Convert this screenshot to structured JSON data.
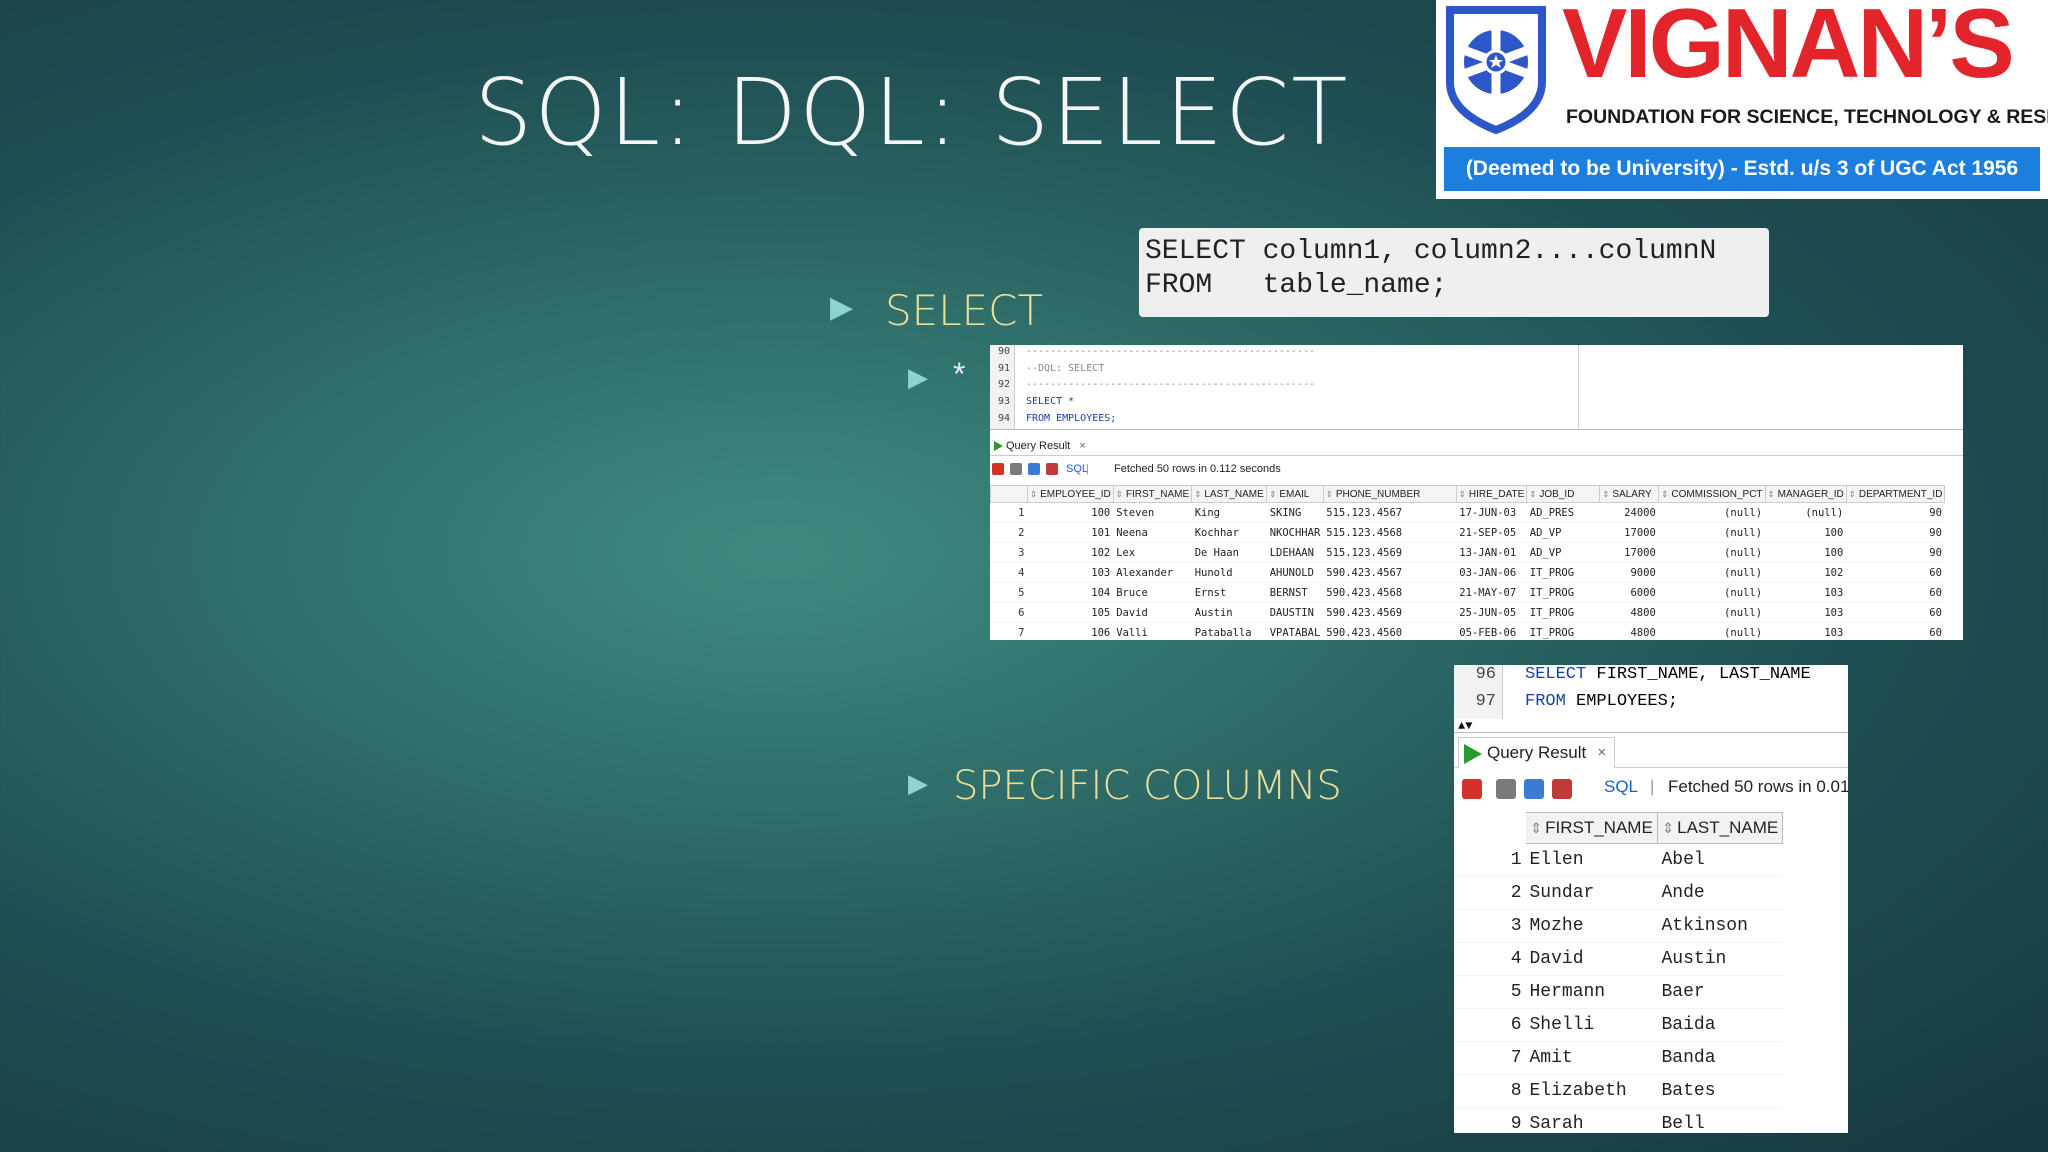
{
  "slide": {
    "title": "SQL: DQL: SELECT",
    "bullets": {
      "select": "SELECT",
      "star": "*",
      "specific": "SPECIFIC COLUMNS"
    },
    "syntax": {
      "line1": "SELECT column1, column2....columnN",
      "line2": "FROM   table_name;"
    }
  },
  "logo": {
    "brand": "VIGNAN’S",
    "subtitle": "FOUNDATION FOR SCIENCE, TECHNOLOGY & RESEARCH",
    "band": "(Deemed to be University) - Estd. u/s 3 of UGC Act 1956",
    "colors": {
      "brand": "#e3242b",
      "band": "#1c7fe0",
      "emblem": "#2d57c8"
    }
  },
  "shot1": {
    "gutter": [
      "90",
      "91",
      "92",
      "93",
      "94"
    ],
    "code": [
      "------------------------------------------------",
      "--DQL: SELECT",
      "------------------------------------------------",
      "SELECT *",
      "FROM EMPLOYEES;"
    ],
    "tab_label": "Query Result",
    "tab_close": "×",
    "sql_label": "SQL",
    "status": "Fetched 50 rows in 0.112 seconds",
    "columns": [
      "EMPLOYEE_ID",
      "FIRST_NAME",
      "LAST_NAME",
      "EMAIL",
      "PHONE_NUMBER",
      "HIRE_DATE",
      "JOB_ID",
      "SALARY",
      "COMMISSION_PCT",
      "MANAGER_ID",
      "DEPARTMENT_ID"
    ],
    "rows": [
      [
        "1",
        "100",
        "Steven",
        "King",
        "SKING",
        "515.123.4567",
        "17-JUN-03",
        "AD_PRES",
        "24000",
        "(null)",
        "(null)",
        "90"
      ],
      [
        "2",
        "101",
        "Neena",
        "Kochhar",
        "NKOCHHAR",
        "515.123.4568",
        "21-SEP-05",
        "AD_VP",
        "17000",
        "(null)",
        "100",
        "90"
      ],
      [
        "3",
        "102",
        "Lex",
        "De Haan",
        "LDEHAAN",
        "515.123.4569",
        "13-JAN-01",
        "AD_VP",
        "17000",
        "(null)",
        "100",
        "90"
      ],
      [
        "4",
        "103",
        "Alexander",
        "Hunold",
        "AHUNOLD",
        "590.423.4567",
        "03-JAN-06",
        "IT_PROG",
        "9000",
        "(null)",
        "102",
        "60"
      ],
      [
        "5",
        "104",
        "Bruce",
        "Ernst",
        "BERNST",
        "590.423.4568",
        "21-MAY-07",
        "IT_PROG",
        "6000",
        "(null)",
        "103",
        "60"
      ],
      [
        "6",
        "105",
        "David",
        "Austin",
        "DAUSTIN",
        "590.423.4569",
        "25-JUN-05",
        "IT_PROG",
        "4800",
        "(null)",
        "103",
        "60"
      ],
      [
        "7",
        "106",
        "Valli",
        "Pataballa",
        "VPATABAL",
        "590.423.4560",
        "05-FEB-06",
        "IT_PROG",
        "4800",
        "(null)",
        "103",
        "60"
      ]
    ]
  },
  "shot2": {
    "gutter": [
      "96",
      "97"
    ],
    "code": [
      {
        "kw": "SELECT",
        "rest": " FIRST_NAME, LAST_NAME"
      },
      {
        "kw": "FROM",
        "rest": " EMPLOYEES;"
      }
    ],
    "tab_label": "Query Result",
    "tab_close": "×",
    "sql_label": "SQL",
    "status": "Fetched 50 rows in 0.01",
    "columns": [
      "FIRST_NAME",
      "LAST_NAME"
    ],
    "rows": [
      [
        "1",
        "Ellen",
        "Abel"
      ],
      [
        "2",
        "Sundar",
        "Ande"
      ],
      [
        "3",
        "Mozhe",
        "Atkinson"
      ],
      [
        "4",
        "David",
        "Austin"
      ],
      [
        "5",
        "Hermann",
        "Baer"
      ],
      [
        "6",
        "Shelli",
        "Baida"
      ],
      [
        "7",
        "Amit",
        "Banda"
      ],
      [
        "8",
        "Elizabeth",
        "Bates"
      ],
      [
        "9",
        "Sarah",
        "Bell"
      ]
    ]
  },
  "icons": [
    "pin-icon",
    "print-icon",
    "refresh-icon",
    "clear-icon",
    "play-icon",
    "sort-icon"
  ]
}
